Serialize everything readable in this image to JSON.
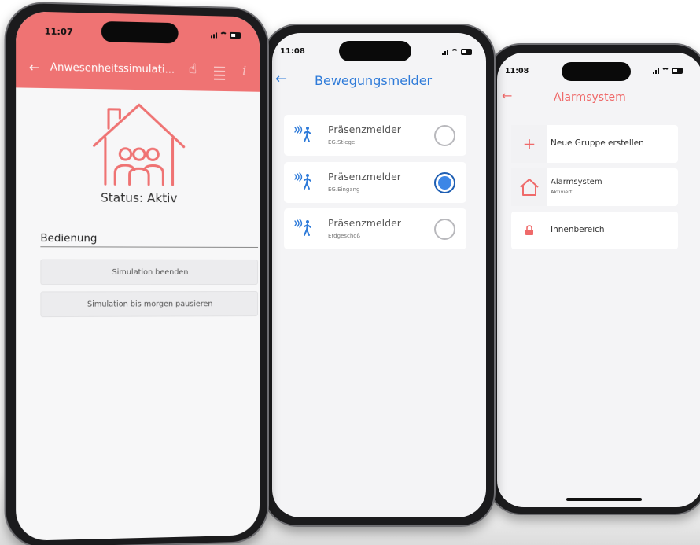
{
  "phone1": {
    "time": "11:07",
    "header_title": "Anwesenheitssimulati...",
    "icons": [
      "back-arrow-icon",
      "hand-pointer-icon",
      "list-icon",
      "info-icon"
    ],
    "status_text": "Status: Aktiv",
    "section_label": "Bedienung",
    "buttons": [
      "Simulation beenden",
      "Simulation bis morgen pausieren"
    ],
    "accent": "#ef7373"
  },
  "phone2": {
    "time": "11:08",
    "title": "Bewegungsmelder",
    "accent": "#2f7bd9",
    "items": [
      {
        "name": "Präsenzmelder",
        "location": "EG.Stiege",
        "selected": false
      },
      {
        "name": "Präsenzmelder",
        "location": "EG.Eingang",
        "selected": true
      },
      {
        "name": "Präsenzmelder",
        "location": "Erdgeschoß",
        "selected": false
      }
    ]
  },
  "phone3": {
    "time": "11:08",
    "title": "Alarmsystem",
    "accent": "#ef6a6a",
    "items": [
      {
        "label": "Neue Gruppe erstellen",
        "icon": "plus-icon"
      },
      {
        "label": "Alarmsystem",
        "sub": "Aktiviert",
        "icon": "house-icon"
      },
      {
        "label": "Innenbereich",
        "icon": "lock-icon"
      }
    ]
  }
}
